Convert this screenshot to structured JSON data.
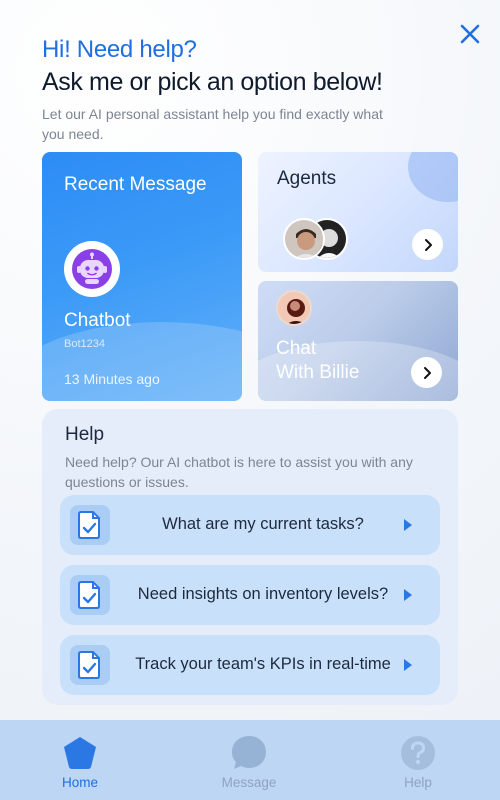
{
  "header": {
    "greeting": "Hi! Need help?",
    "headline": "Ask me or pick an option below!",
    "subtitle": "Let our AI personal assistant help you find exactly what you need.",
    "close_icon": "close-icon"
  },
  "recent_message": {
    "title": "Recent Message",
    "name": "Chatbot",
    "handle": "Bot1234",
    "time": "13 Minutes  ago",
    "avatar_icon": "robot-icon"
  },
  "agents": {
    "title": "Agents",
    "arrow_icon": "chevron-right-icon"
  },
  "chat_billie": {
    "title_line1": "Chat",
    "title_line2": "With Billie",
    "arrow_icon": "chevron-right-icon"
  },
  "help": {
    "title": "Help",
    "description": "Need help? Our AI chatbot is here to assist you with any questions or issues.",
    "items": [
      {
        "label": "What are my current tasks?",
        "icon": "checklist-icon"
      },
      {
        "label": "Need insights on inventory levels?",
        "icon": "checklist-icon"
      },
      {
        "label": "Track your team's KPIs in real-time",
        "icon": "checklist-icon"
      }
    ]
  },
  "tabbar": {
    "tabs": [
      {
        "label": "Home",
        "icon": "home-pentagon-icon",
        "active": true
      },
      {
        "label": "Message",
        "icon": "chat-bubble-icon",
        "active": false
      },
      {
        "label": "Help",
        "icon": "question-icon",
        "active": false
      }
    ]
  },
  "colors": {
    "accent": "#1f6fe0",
    "card_blue": "#2d8cf5",
    "help_panel": "#e4edf9",
    "tabbar": "#bcd6f3",
    "inactive_tab": "#8fa3bd"
  }
}
